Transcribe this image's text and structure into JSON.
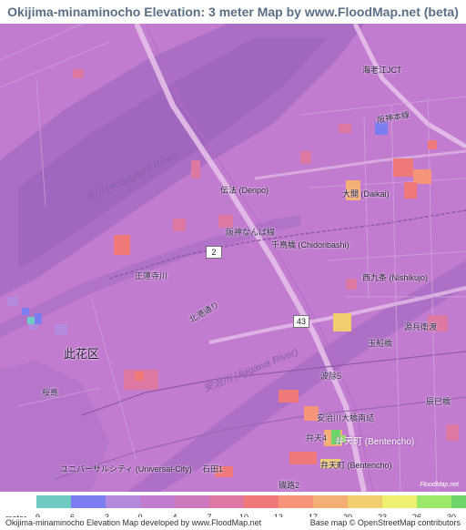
{
  "title": "Okijima-minaminocho Elevation: 3 meter Map by www.FloodMap.net (beta)",
  "labels": {
    "yodogawa_river": "淀川 (Yodogawa River)",
    "ajigawa_river": "安治川 (Ajigawa River)",
    "denpo": "伝法 (Denpo)",
    "daikai": "大開 (Daikai)",
    "chidoribashi": "千鳥橋 (Chidoribashi)",
    "nishikujo": "西九条 (Nishikujo)",
    "konohana_ku": "此花区",
    "ebiejct": "海老江JCT",
    "universal_city": "ユニバーサルシティ (Universal-City)",
    "bentencho1": "弁天町 (Bentencho)",
    "bentencho2": "弁天町 (Bentencho)",
    "hanshin_line": "阪神本線",
    "hanshin_namba": "阪神なんば線",
    "shojinjigawa": "正蓮寺川",
    "kitako_dori": "北港通り",
    "sakurajima": "桜島",
    "genbe": "源兵衛渡",
    "tamaebashi": "玉船橋",
    "namiyoke": "波除5",
    "ajikawa_ohashi": "安治川大橋南詰",
    "benten4": "弁天4",
    "ishida1": "石田1",
    "isoji2": "磯路2",
    "tatsumi": "辰巳橋",
    "attribution_map": "FloodMap.net"
  },
  "route_shields": [
    "2",
    "43",
    "43"
  ],
  "scale": {
    "unit_label": "meter",
    "colors": [
      "#6fcac2",
      "#7b7df0",
      "#b389dd",
      "#c17ccf",
      "#cd78bd",
      "#dc78a3",
      "#ef7878",
      "#f5947a",
      "#f4b074",
      "#f0cd6e",
      "#efef70",
      "#9be86a",
      "#6fd46a"
    ],
    "values": [
      "-9",
      "-6",
      "-3",
      "0",
      "4",
      "7",
      "10",
      "13",
      "17",
      "20",
      "23",
      "26",
      "30"
    ]
  },
  "footer": {
    "left": "Okijima-minaminocho Elevation Map developed by www.FloodMap.net",
    "right": "Base map © OpenStreetMap contributors"
  }
}
